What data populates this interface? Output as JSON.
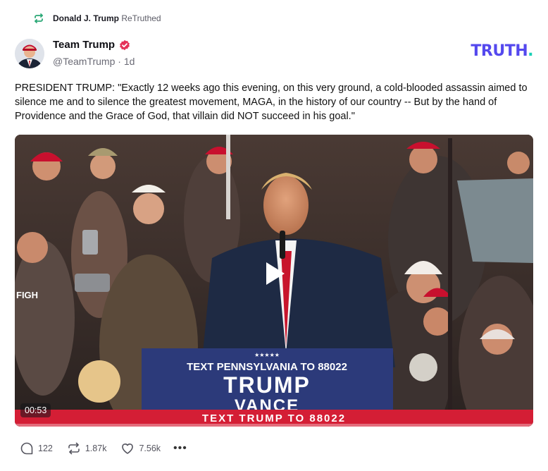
{
  "retruth": {
    "user": "Donald J. Trump",
    "action": "ReTruthed"
  },
  "author": {
    "name": "Team Trump",
    "handle": "@TeamTrump",
    "age": "1d"
  },
  "logo": {
    "text": "TRUTH",
    "dot": "."
  },
  "post": {
    "text": "PRESIDENT TRUMP: \"Exactly 12 weeks ago this evening, on this very ground, a cold-blooded assassin aimed to silence me and to silence the greatest movement, MAGA, in the history of our country -- But by the hand of Providence and the Grace of God, that villain did NOT succeed in his goal.\""
  },
  "video": {
    "duration": "00:53",
    "podium_stars": "★★★★★",
    "podium_line1": "TEXT PENNSYLVANIA TO 88022",
    "podium_line2": "TRUMP",
    "podium_line3": "VANCE",
    "banner": "TEXT TRUMP TO 88022",
    "cap_text": "FIGH"
  },
  "actions": {
    "replies": "122",
    "retruths": "1.87k",
    "likes": "7.56k",
    "more": "•••"
  },
  "colors": {
    "brand": "#5448ee",
    "brand_dot": "#18d0b6",
    "verified": "#e53258",
    "banner_red": "#d41e35",
    "retruth_green": "#2aa876"
  }
}
